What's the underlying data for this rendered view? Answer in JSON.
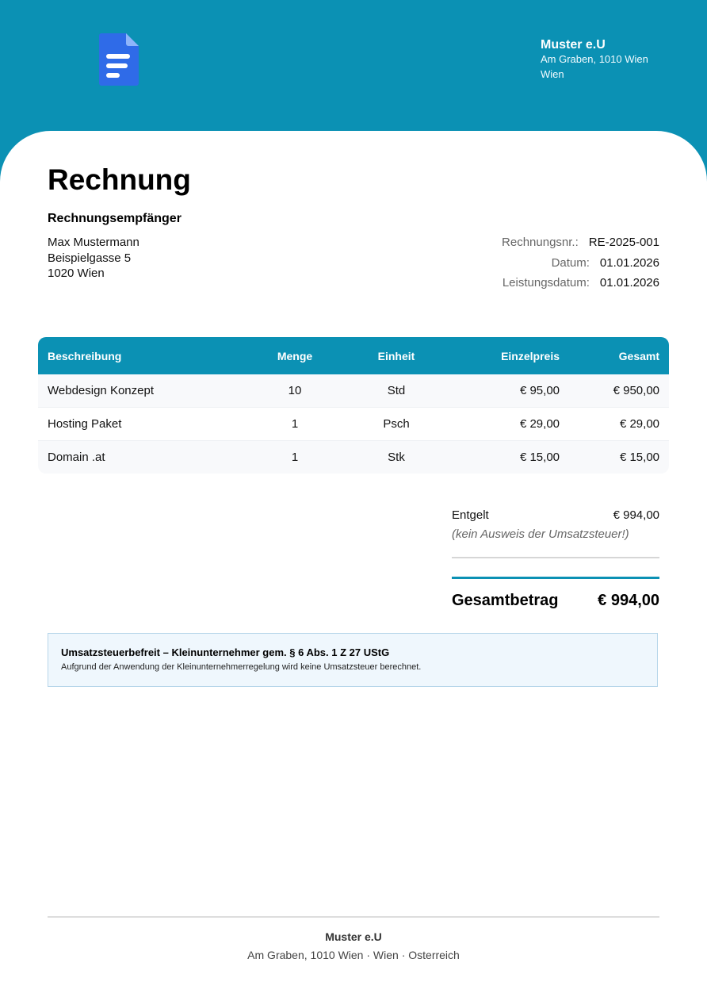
{
  "header": {
    "logo_icon": "document-icon",
    "company_name": "Muster e.U",
    "company_address_line1": "Am Graben, 1010 Wien",
    "company_address_line2": "Wien",
    "band_color": "#0b91b4"
  },
  "invoice": {
    "title": "Rechnung",
    "recipient_label": "Rechnungsempfänger",
    "recipient": {
      "name": "Max Mustermann",
      "street": "Beispielgasse 5",
      "city": "1020 Wien"
    },
    "meta": [
      {
        "label": "Rechnungsnr.:",
        "value": "RE-2025-001"
      },
      {
        "label": "Datum:",
        "value": "01.01.2026"
      },
      {
        "label": "Leistungsdatum:",
        "value": "01.01.2026"
      }
    ]
  },
  "table": {
    "columns": [
      "Beschreibung",
      "Menge",
      "Einheit",
      "Einzelpreis",
      "Gesamt"
    ],
    "rows": [
      [
        "Webdesign Konzept",
        "10",
        "Std",
        "€ 95,00",
        "€ 950,00"
      ],
      [
        "Hosting Paket",
        "1",
        "Psch",
        "€ 29,00",
        "€ 29,00"
      ],
      [
        "Domain .at",
        "1",
        "Stk",
        "€ 15,00",
        "€ 15,00"
      ]
    ]
  },
  "totals": {
    "net_label": "Entgelt",
    "net_value": "€ 994,00",
    "vat_note": "(kein Ausweis der Umsatzsteuer!)",
    "grand_label": "Gesamtbetrag",
    "grand_value": "€ 994,00"
  },
  "notice": {
    "title": "Umsatzsteuerbefreit – Kleinunternehmer gem. § 6 Abs. 1 Z 27 UStG",
    "text": "Aufgrund der Anwendung der Kleinunternehmerregelung wird keine Umsatzsteuer berechnet."
  },
  "footer": {
    "company_name": "Muster e.U",
    "address": "Am Graben, 1010 Wien · Wien · Osterreich"
  }
}
